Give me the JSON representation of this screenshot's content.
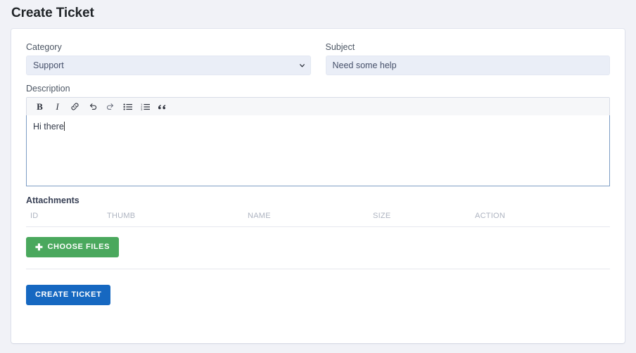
{
  "page": {
    "title": "Create Ticket",
    "background_color": "#f1f2f7"
  },
  "form": {
    "category": {
      "label": "Category",
      "value": "Support",
      "options": [
        "Support"
      ],
      "chevron_icon": "chevron-down-icon"
    },
    "subject": {
      "label": "Subject",
      "value": "Need some help",
      "placeholder": "Subject"
    },
    "description": {
      "label": "Description",
      "value": "Hi there",
      "toolbar": [
        {
          "name": "bold-icon",
          "glyph": "B",
          "title": "Bold"
        },
        {
          "name": "italic-icon",
          "glyph": "I",
          "title": "Italic"
        },
        {
          "name": "link-icon",
          "glyph": "",
          "title": "Link"
        },
        {
          "name": "undo-icon",
          "glyph": "",
          "title": "Undo"
        },
        {
          "name": "redo-icon",
          "glyph": "",
          "title": "Redo"
        },
        {
          "name": "unordered-list-icon",
          "glyph": "",
          "title": "Bullet list"
        },
        {
          "name": "ordered-list-icon",
          "glyph": "",
          "title": "Numbered list"
        },
        {
          "name": "quote-icon",
          "glyph": "“",
          "title": "Blockquote"
        }
      ]
    }
  },
  "attachments": {
    "title": "Attachments",
    "columns": [
      "ID",
      "THUMB",
      "NAME",
      "SIZE",
      "ACTION"
    ],
    "rows": [],
    "choose_files_label": "CHOOSE FILES",
    "choose_files_icon": "plus-icon",
    "choose_files_color": "#4aa85d"
  },
  "actions": {
    "submit_label": "CREATE TICKET",
    "submit_color": "#1668c1"
  }
}
